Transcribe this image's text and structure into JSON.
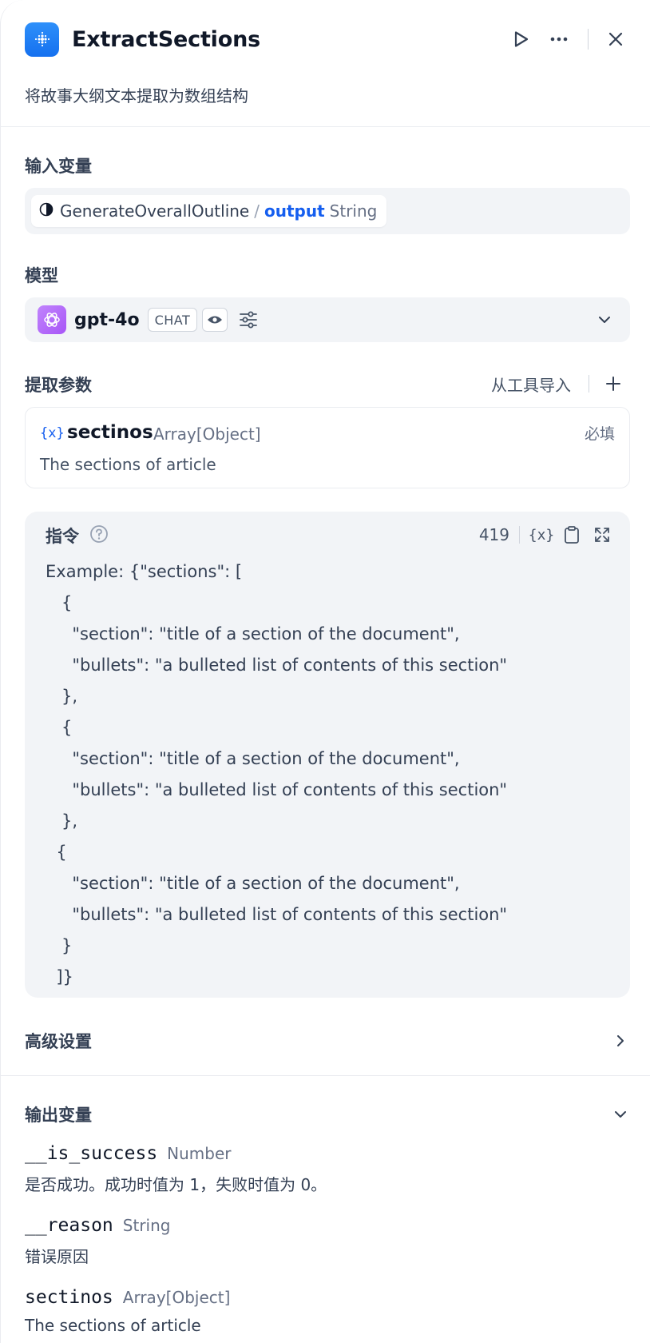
{
  "header": {
    "title": "ExtractSections",
    "description": "将故事大纲文本提取为数组结构",
    "icons": [
      "app-icon",
      "play-icon",
      "more-icon",
      "close-icon"
    ]
  },
  "input": {
    "label": "输入变量",
    "node": "GenerateOverallOutline",
    "separator": "/",
    "var": "output",
    "type": "String"
  },
  "model": {
    "label": "模型",
    "name": "gpt-4o",
    "mode": "CHAT"
  },
  "params": {
    "label": "提取参数",
    "import_label": "从工具导入",
    "var_icon": "{x}",
    "items": [
      {
        "name": "sectinos",
        "type": "Array[Object]",
        "required": "必填",
        "description": "The sections of article"
      }
    ]
  },
  "instruction": {
    "label": "指令",
    "count": "419",
    "var_icon": "{x}",
    "text": "Example: {\"sections\": [\n   {\n     \"section\": \"title of a section of the document\",\n     \"bullets\": \"a bulleted list of contents of this section\"\n   },\n   {\n     \"section\": \"title of a section of the document\",\n     \"bullets\": \"a bulleted list of contents of this section\"\n   },\n  {\n     \"section\": \"title of a section of the document\",\n     \"bullets\": \"a bulleted list of contents of this section\"\n   }\n  ]}"
  },
  "advanced": {
    "label": "高级设置"
  },
  "output": {
    "label": "输出变量",
    "items": [
      {
        "name": "__is_success",
        "type": "Number",
        "description": "是否成功。成功时值为 1，失败时值为 0。"
      },
      {
        "name": "__reason",
        "type": "String",
        "description": "错误原因"
      },
      {
        "name": "sectinos",
        "type": "Array[Object]",
        "description": "The sections of article"
      }
    ]
  },
  "colors": {
    "accent": "#155eef",
    "app_icon": "#2e90fa",
    "model_icon": "#a855f7",
    "field_bg": "#f2f4f7"
  }
}
